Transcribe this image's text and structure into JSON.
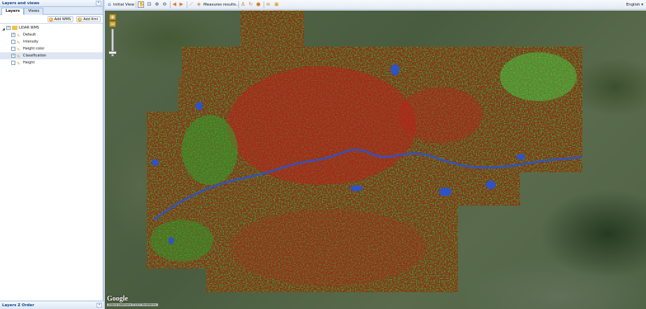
{
  "left_panel": {
    "title": "Layers and views",
    "collapse_glyph": "«",
    "tabs": [
      {
        "label": "Layers",
        "active": true
      },
      {
        "label": "Views",
        "active": false
      }
    ],
    "toolbar": {
      "add_wms": "Add WMS",
      "add_kml": "Add Kml"
    },
    "tree": {
      "root": {
        "label": "LIDAR WMS",
        "checked": true,
        "expanded": true
      },
      "children": [
        {
          "label": "Default",
          "checked": true,
          "selected": false
        },
        {
          "label": "Intensity",
          "checked": false,
          "selected": false
        },
        {
          "label": "Height color",
          "checked": false,
          "selected": false
        },
        {
          "label": "Classification",
          "checked": true,
          "selected": true
        },
        {
          "label": "Height",
          "checked": false,
          "selected": false
        }
      ]
    },
    "zorder_title": "Layers Z Order",
    "zorder_glyph": "»"
  },
  "toolbar": {
    "initial_view": "Initial View",
    "measures": "Measures results...",
    "language": "English",
    "icons": [
      "home-icon",
      "pan-hand-icon",
      "zoom-box-icon",
      "zoom-in-icon",
      "zoom-out-icon",
      "back-arrow-icon",
      "forward-arrow-icon",
      "measure-ruler-icon",
      "measure-area-icon",
      "info-icon",
      "refresh-icon",
      "stop-icon",
      "export-icon",
      "image-icon"
    ]
  },
  "map": {
    "zoom_in": "+",
    "zoom_out": "−",
    "google_label": "Google",
    "attribution": "Zdjęcie satelitarne ©2015 TerraMetrics"
  },
  "colors": {
    "panel_header": "#dde8f5",
    "accent": "#15428b",
    "lidar_ground": "#b82a1c",
    "lidar_vegetation": "#27c83a",
    "lidar_water": "#2d53c9"
  }
}
